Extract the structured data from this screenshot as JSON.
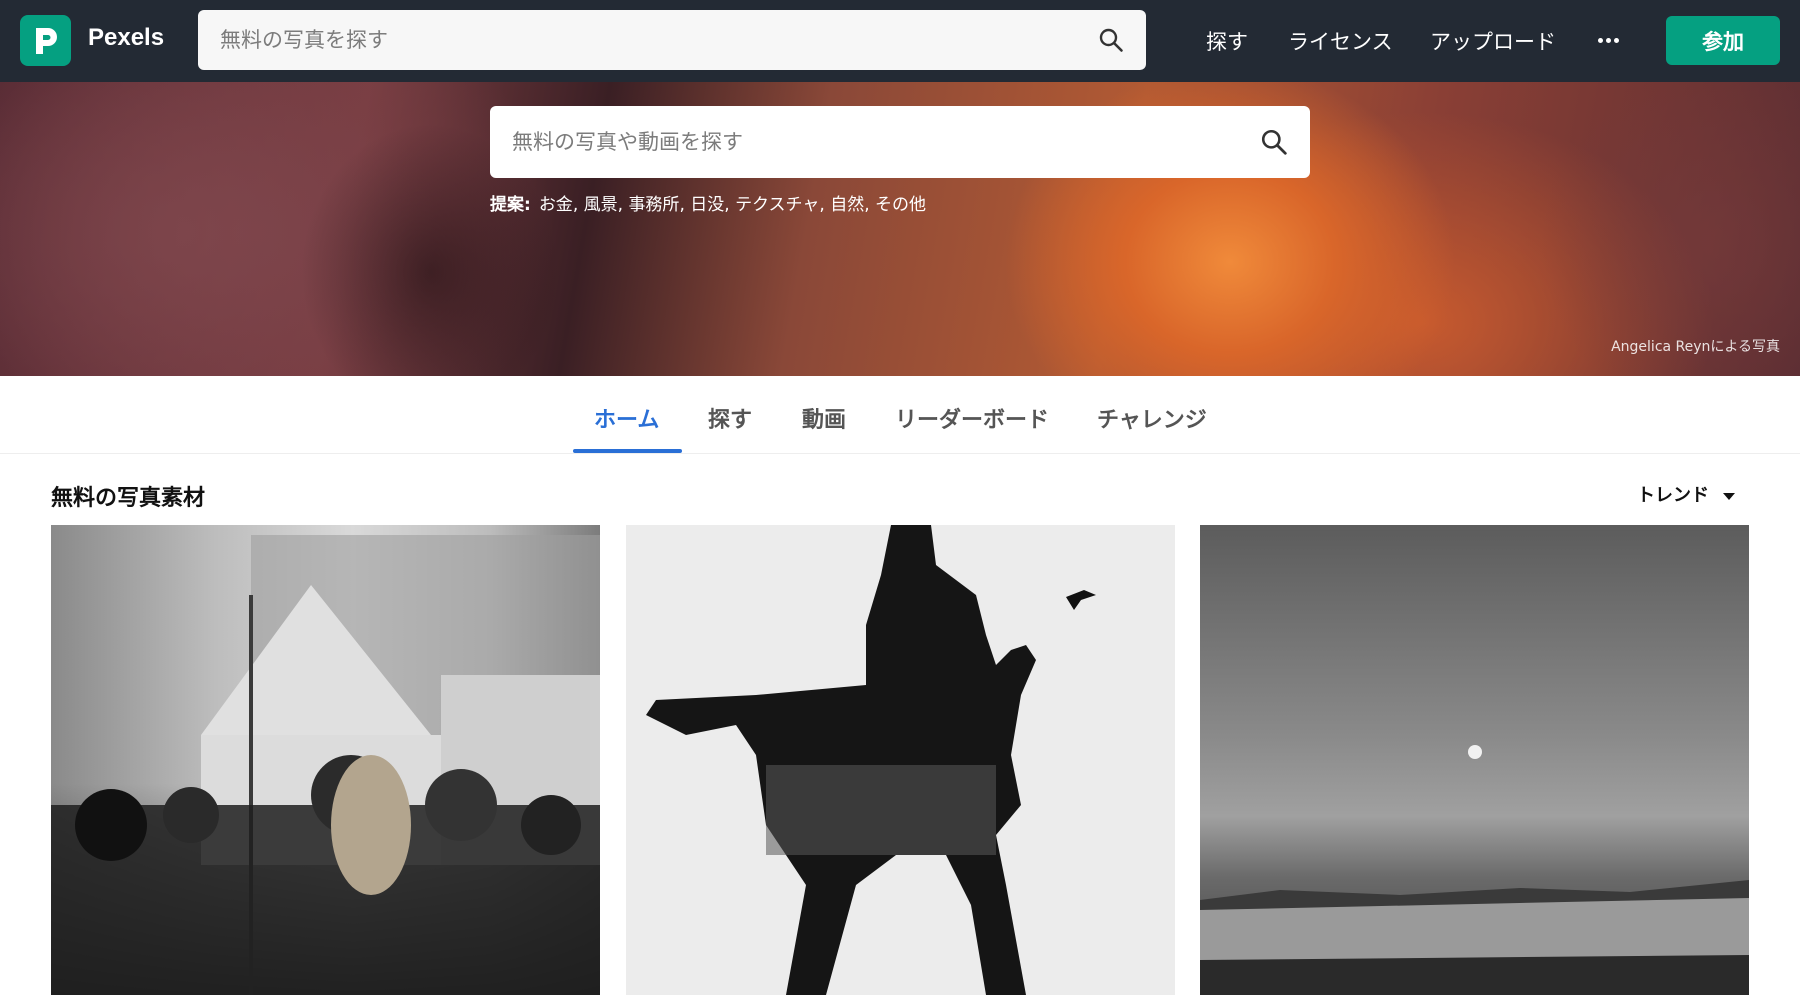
{
  "header": {
    "brand": "Pexels",
    "search_placeholder": "無料の写真を探す",
    "nav": [
      "探す",
      "ライセンス",
      "アップロード"
    ],
    "join_label": "参加"
  },
  "hero": {
    "search_placeholder": "無料の写真や動画を探す",
    "suggest_label": "提案:",
    "suggestions": [
      "お金",
      "風景",
      "事務所",
      "日没",
      "テクスチャ",
      "自然",
      "その他"
    ],
    "credit": "Angelica Reynによる写真"
  },
  "tabs": [
    {
      "label": "ホーム",
      "active": true
    },
    {
      "label": "探す",
      "active": false
    },
    {
      "label": "動画",
      "active": false
    },
    {
      "label": "リーダーボード",
      "active": false
    },
    {
      "label": "チャレンジ",
      "active": false
    }
  ],
  "section": {
    "title": "無料の写真素材",
    "sort_label": "トレンド"
  },
  "colors": {
    "topbar": "#232a34",
    "brand_green": "#05a081",
    "tab_active": "#2a6fd6"
  },
  "icons": {
    "logo": "pexels-logo-icon",
    "search": "search-icon",
    "more": "more-dots-icon",
    "caret": "caret-down-icon"
  }
}
